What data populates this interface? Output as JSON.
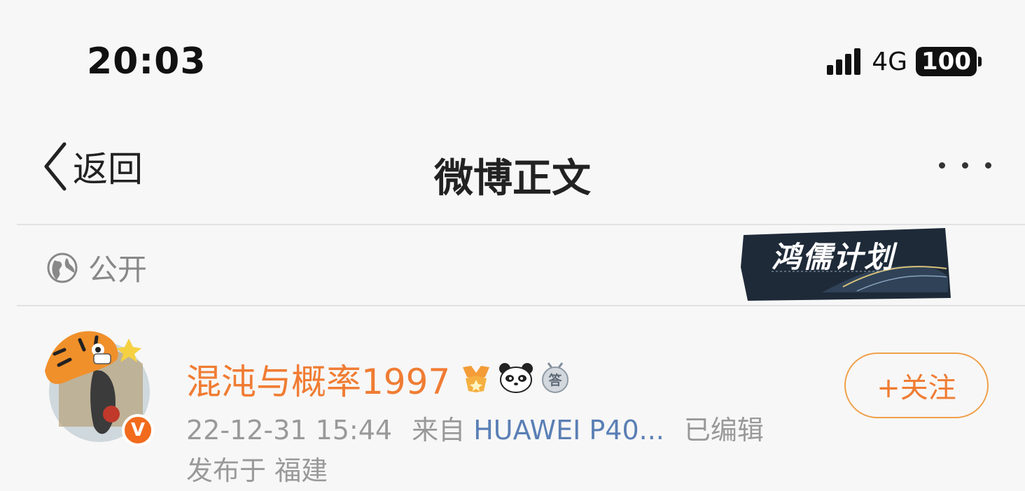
{
  "status_bar": {
    "time": "20:03",
    "network": "4G",
    "battery": "100"
  },
  "nav": {
    "back_label": "返回",
    "title": "微博正文"
  },
  "post_header": {
    "visibility": "公开",
    "banner_text": "鸿儒计划"
  },
  "author": {
    "name": "混沌与概率1997",
    "verified_mark": "V",
    "badges": [
      "medal-icon",
      "panda-icon",
      "answer-badge-icon"
    ],
    "answer_badge_char": "答"
  },
  "meta": {
    "date": "22-12-31 15:44",
    "from_prefix": "来自",
    "source": "HUAWEI P40...",
    "edited": "已编辑",
    "location_prefix": "发布于",
    "location": "福建"
  },
  "follow_button": {
    "label": "+关注"
  },
  "colors": {
    "accent_orange": "#f07c33",
    "link_blue": "#5a7fb5",
    "background": "#f7f7f7"
  }
}
